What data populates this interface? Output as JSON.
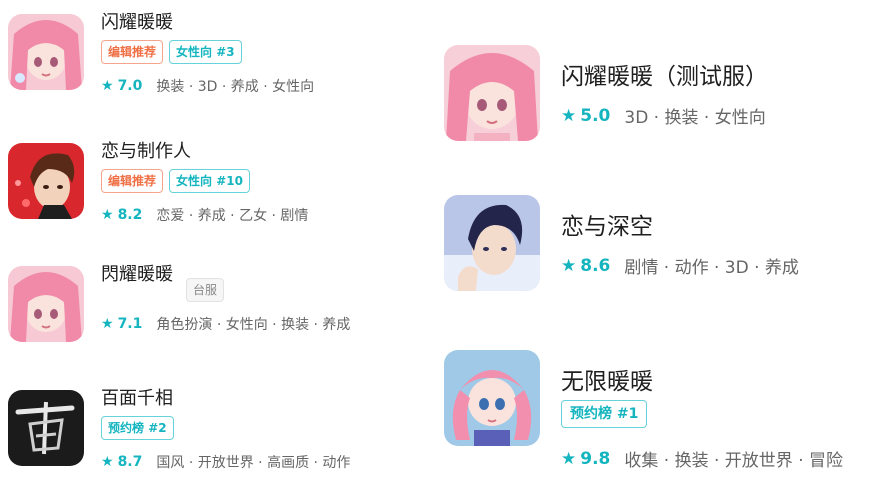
{
  "left_apps": [
    {
      "title": "闪耀暖暖",
      "badges": [
        {
          "text": "编辑推荐",
          "style": "orange"
        },
        {
          "text": "女性向",
          "rank": "#3",
          "style": "teal"
        }
      ],
      "rating": "7.0",
      "tags": "换装 · 3D · 养成 · 女性向",
      "icon": "pink-hair-girl-icon"
    },
    {
      "title": "恋与制作人",
      "badges": [
        {
          "text": "编辑推荐",
          "style": "orange"
        },
        {
          "text": "女性向",
          "rank": "#10",
          "style": "teal"
        }
      ],
      "rating": "8.2",
      "tags": "恋爱 · 养成 · 乙女 · 剧情",
      "icon": "brown-hair-boy-icon"
    },
    {
      "title": "閃耀暖暖",
      "badges": [
        {
          "text": "台服",
          "style": "gray"
        }
      ],
      "rating": "7.1",
      "tags": "角色扮演 · 女性向 · 换装 · 养成",
      "icon": "pink-hair-girl-icon"
    },
    {
      "title": "百面千相",
      "badges": [
        {
          "text": "预约榜",
          "rank": "#2",
          "style": "teal"
        }
      ],
      "rating": "8.7",
      "tags": "国风 · 开放世界 · 高画质 · 动作",
      "icon": "ink-calligraphy-icon"
    }
  ],
  "right_apps": [
    {
      "title": "闪耀暖暖（测试服）",
      "badges": [],
      "rating": "5.0",
      "tags": "3D · 换装 · 女性向",
      "icon": "pink-hair-girl-icon"
    },
    {
      "title": "恋与深空",
      "badges": [],
      "rating": "8.6",
      "tags": "剧情 · 动作 · 3D · 养成",
      "icon": "dark-hair-boy-icon"
    },
    {
      "title": "无限暖暖",
      "badges": [
        {
          "text": "预约榜",
          "rank": "#1",
          "style": "teal"
        }
      ],
      "rating": "9.8",
      "tags": "收集 · 换装 · 开放世界 · 冒险",
      "icon": "pink-twin-tail-girl-icon"
    }
  ],
  "colors": {
    "accent": "#15b5bf",
    "orange": "#f07046"
  }
}
